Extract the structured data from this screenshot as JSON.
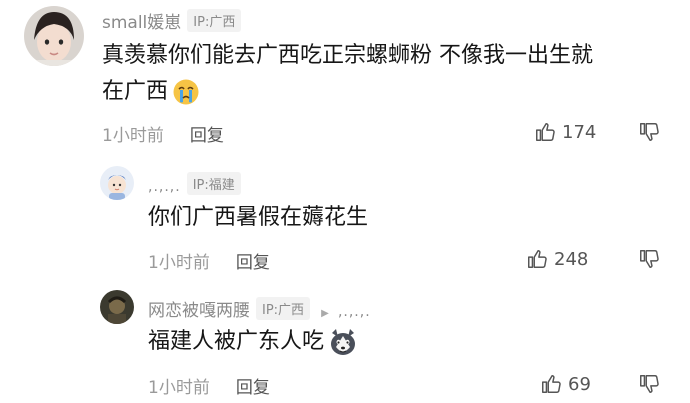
{
  "comments": [
    {
      "user": "small媛崽",
      "ip": "IP:广西",
      "text_line1": "真羡慕你们能去广西吃正宗螺蛳粉 不像我一出生就",
      "text_line2": "在广西",
      "time": "1小时前",
      "reply": "回复",
      "likes": "174"
    },
    {
      "user": ",.,.,.",
      "ip": "IP:福建",
      "text": "你们广西暑假在薅花生",
      "time": "1小时前",
      "reply": "回复",
      "likes": "248"
    },
    {
      "user": "网恋被嘎两腰",
      "ip": "IP:广西",
      "reply_to": ",.,.,.",
      "text": "福建人被广东人吃",
      "time": "1小时前",
      "reply": "回复",
      "likes": "69"
    }
  ],
  "icons": {
    "crying": "crying-emoji-icon",
    "husky": "husky-emoji-icon",
    "like": "thumbs-up-icon",
    "dislike": "thumbs-down-icon"
  }
}
